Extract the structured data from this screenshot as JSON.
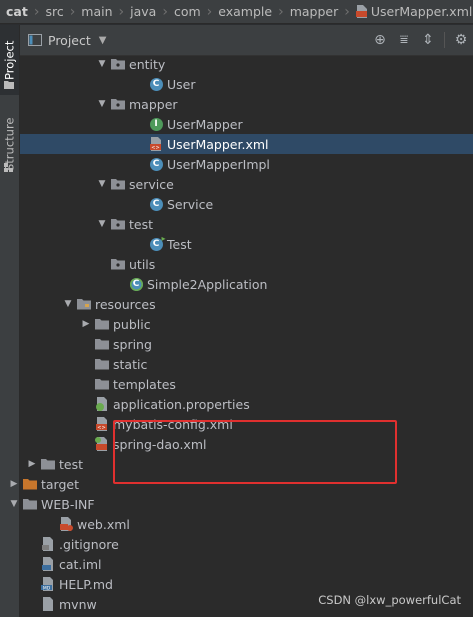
{
  "breadcrumb": [
    "cat",
    "src",
    "main",
    "java",
    "com",
    "example",
    "mapper",
    "UserMapper.xml"
  ],
  "sidebar": {
    "project_tab": "Project",
    "structure_tab": "Structure"
  },
  "panel": {
    "title": "Project"
  },
  "tree": [
    {
      "label": "entity",
      "kind": "package",
      "arrow": "down"
    },
    {
      "label": "User",
      "kind": "class",
      "arrow": ""
    },
    {
      "label": "mapper",
      "kind": "package",
      "arrow": "down"
    },
    {
      "label": "UserMapper",
      "kind": "interface",
      "arrow": ""
    },
    {
      "label": "UserMapper.xml",
      "kind": "xml",
      "arrow": "",
      "selected": true
    },
    {
      "label": "UserMapperImpl",
      "kind": "class",
      "arrow": ""
    },
    {
      "label": "service",
      "kind": "package",
      "arrow": "down"
    },
    {
      "label": "Service",
      "kind": "class",
      "arrow": ""
    },
    {
      "label": "test",
      "kind": "package",
      "arrow": "down"
    },
    {
      "label": "Test",
      "kind": "class-run",
      "arrow": ""
    },
    {
      "label": "utils",
      "kind": "package",
      "arrow": ""
    },
    {
      "label": "Simple2Application",
      "kind": "spring-class",
      "arrow": ""
    },
    {
      "label": "resources",
      "kind": "res-folder",
      "arrow": "down"
    },
    {
      "label": "public",
      "kind": "folder",
      "arrow": "right"
    },
    {
      "label": "spring",
      "kind": "folder",
      "arrow": ""
    },
    {
      "label": "static",
      "kind": "folder",
      "arrow": ""
    },
    {
      "label": "templates",
      "kind": "folder",
      "arrow": ""
    },
    {
      "label": "application.properties",
      "kind": "properties",
      "arrow": ""
    },
    {
      "label": "mybatis-config.xml",
      "kind": "xml",
      "arrow": ""
    },
    {
      "label": "spring-dao.xml",
      "kind": "xml-spring",
      "arrow": ""
    },
    {
      "label": "test",
      "kind": "folder",
      "arrow": "right"
    },
    {
      "label": "target",
      "kind": "folder-orange",
      "arrow": "right"
    },
    {
      "label": "WEB-INF",
      "kind": "folder",
      "arrow": "down"
    },
    {
      "label": "web.xml",
      "kind": "xml-web",
      "arrow": ""
    },
    {
      "label": ".gitignore",
      "kind": "gitignore",
      "arrow": ""
    },
    {
      "label": "cat.iml",
      "kind": "iml",
      "arrow": ""
    },
    {
      "label": "HELP.md",
      "kind": "md",
      "arrow": ""
    },
    {
      "label": "mvnw",
      "kind": "file",
      "arrow": ""
    }
  ],
  "watermark": "CSDN @lxw_powerfulCat",
  "colors": {
    "selection": "#2f4a66",
    "highlight_box": "#e0302f",
    "folder": "#8d9096",
    "folder_orange": "#c7762c",
    "class_icon": "#4c8eb9",
    "interface_icon": "#4e9a5b"
  }
}
